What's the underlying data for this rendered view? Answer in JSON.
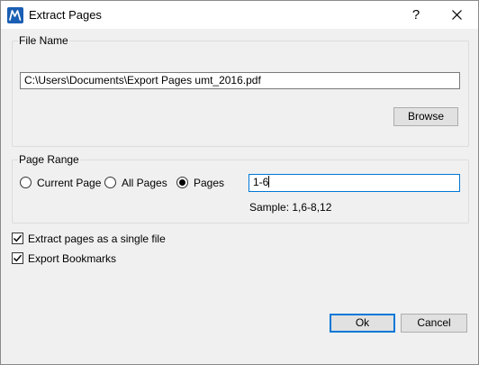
{
  "window": {
    "title": "Extract Pages",
    "help_label": "?"
  },
  "file_name": {
    "group_label": "File Name",
    "path_value": "C:\\Users\\Documents\\Export Pages umt_2016.pdf",
    "browse_label": "Browse"
  },
  "page_range": {
    "group_label": "Page Range",
    "options": [
      {
        "label": "Current Page",
        "selected": false
      },
      {
        "label": "All Pages",
        "selected": false
      },
      {
        "label": "Pages",
        "selected": true
      }
    ],
    "pages_value": "1-6",
    "sample_text": "Sample: 1,6-8,12"
  },
  "options": {
    "single_file_label": "Extract pages as a single file",
    "single_file_checked": true,
    "bookmarks_label": "Export Bookmarks",
    "bookmarks_checked": true
  },
  "footer": {
    "ok_label": "Ok",
    "cancel_label": "Cancel"
  },
  "colors": {
    "accent": "#0078d7",
    "app_icon": "#1a5fb4"
  }
}
